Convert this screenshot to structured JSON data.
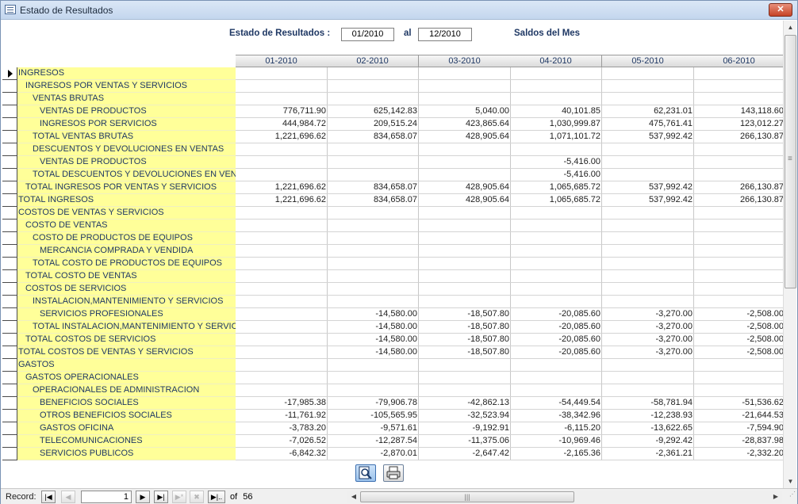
{
  "window": {
    "title": "Estado de Resultados",
    "close_glyph": "✕"
  },
  "header": {
    "label": "Estado de Resultados :",
    "from": "01/2010",
    "to_label": "al",
    "to": "12/2010",
    "mode": "Saldos del Mes"
  },
  "columns": [
    "01-2010",
    "02-2010",
    "03-2010",
    "04-2010",
    "05-2010",
    "06-2010"
  ],
  "rows": [
    {
      "label": "INGRESOS",
      "indent": 0,
      "values": [
        "",
        "",
        "",
        "",
        "",
        ""
      ]
    },
    {
      "label": "INGRESOS POR VENTAS Y SERVICIOS",
      "indent": 1,
      "values": [
        "",
        "",
        "",
        "",
        "",
        ""
      ]
    },
    {
      "label": "VENTAS BRUTAS",
      "indent": 2,
      "values": [
        "",
        "",
        "",
        "",
        "",
        ""
      ]
    },
    {
      "label": "VENTAS DE PRODUCTOS",
      "indent": 3,
      "values": [
        "776,711.90",
        "625,142.83",
        "5,040.00",
        "40,101.85",
        "62,231.01",
        "143,118.60"
      ]
    },
    {
      "label": "INGRESOS POR SERVICIOS",
      "indent": 3,
      "values": [
        "444,984.72",
        "209,515.24",
        "423,865.64",
        "1,030,999.87",
        "475,761.41",
        "123,012.27"
      ]
    },
    {
      "label": "TOTAL VENTAS BRUTAS",
      "indent": 2,
      "values": [
        "1,221,696.62",
        "834,658.07",
        "428,905.64",
        "1,071,101.72",
        "537,992.42",
        "266,130.87"
      ]
    },
    {
      "label": "DESCUENTOS Y DEVOLUCIONES EN VENTAS",
      "indent": 2,
      "values": [
        "",
        "",
        "",
        "",
        "",
        ""
      ]
    },
    {
      "label": "VENTAS DE PRODUCTOS",
      "indent": 3,
      "values": [
        "",
        "",
        "",
        "-5,416.00",
        "",
        ""
      ]
    },
    {
      "label": "TOTAL DESCUENTOS Y DEVOLUCIONES EN VENTAS",
      "indent": 2,
      "values": [
        "",
        "",
        "",
        "-5,416.00",
        "",
        ""
      ]
    },
    {
      "label": "TOTAL INGRESOS POR VENTAS Y SERVICIOS",
      "indent": 1,
      "values": [
        "1,221,696.62",
        "834,658.07",
        "428,905.64",
        "1,065,685.72",
        "537,992.42",
        "266,130.87"
      ]
    },
    {
      "label": "TOTAL INGRESOS",
      "indent": 0,
      "values": [
        "1,221,696.62",
        "834,658.07",
        "428,905.64",
        "1,065,685.72",
        "537,992.42",
        "266,130.87"
      ]
    },
    {
      "label": "COSTOS DE VENTAS Y SERVICIOS",
      "indent": 0,
      "values": [
        "",
        "",
        "",
        "",
        "",
        ""
      ]
    },
    {
      "label": "COSTO DE VENTAS",
      "indent": 1,
      "values": [
        "",
        "",
        "",
        "",
        "",
        ""
      ]
    },
    {
      "label": "COSTO DE PRODUCTOS DE EQUIPOS",
      "indent": 2,
      "values": [
        "",
        "",
        "",
        "",
        "",
        ""
      ]
    },
    {
      "label": "MERCANCIA COMPRADA Y VENDIDA",
      "indent": 3,
      "values": [
        "",
        "",
        "",
        "",
        "",
        ""
      ]
    },
    {
      "label": "TOTAL COSTO DE PRODUCTOS DE EQUIPOS",
      "indent": 2,
      "values": [
        "",
        "",
        "",
        "",
        "",
        ""
      ]
    },
    {
      "label": "TOTAL COSTO DE VENTAS",
      "indent": 1,
      "values": [
        "",
        "",
        "",
        "",
        "",
        ""
      ]
    },
    {
      "label": "COSTOS DE SERVICIOS",
      "indent": 1,
      "values": [
        "",
        "",
        "",
        "",
        "",
        ""
      ]
    },
    {
      "label": "INSTALACION,MANTENIMIENTO Y SERVICIOS",
      "indent": 2,
      "values": [
        "",
        "",
        "",
        "",
        "",
        ""
      ]
    },
    {
      "label": "SERVICIOS PROFESIONALES",
      "indent": 3,
      "values": [
        "",
        "-14,580.00",
        "-18,507.80",
        "-20,085.60",
        "-3,270.00",
        "-2,508.00"
      ]
    },
    {
      "label": "TOTAL INSTALACION,MANTENIMIENTO Y SERVICIOS",
      "indent": 2,
      "values": [
        "",
        "-14,580.00",
        "-18,507.80",
        "-20,085.60",
        "-3,270.00",
        "-2,508.00"
      ]
    },
    {
      "label": "TOTAL COSTOS DE SERVICIOS",
      "indent": 1,
      "values": [
        "",
        "-14,580.00",
        "-18,507.80",
        "-20,085.60",
        "-3,270.00",
        "-2,508.00"
      ]
    },
    {
      "label": "TOTAL COSTOS DE VENTAS Y SERVICIOS",
      "indent": 0,
      "values": [
        "",
        "-14,580.00",
        "-18,507.80",
        "-20,085.60",
        "-3,270.00",
        "-2,508.00"
      ]
    },
    {
      "label": "GASTOS",
      "indent": 0,
      "values": [
        "",
        "",
        "",
        "",
        "",
        ""
      ]
    },
    {
      "label": "GASTOS OPERACIONALES",
      "indent": 1,
      "values": [
        "",
        "",
        "",
        "",
        "",
        ""
      ]
    },
    {
      "label": "OPERACIONALES DE ADMINISTRACION",
      "indent": 2,
      "values": [
        "",
        "",
        "",
        "",
        "",
        ""
      ]
    },
    {
      "label": "BENEFICIOS SOCIALES",
      "indent": 3,
      "values": [
        "-17,985.38",
        "-79,906.78",
        "-42,862.13",
        "-54,449.54",
        "-58,781.94",
        "-51,536.62"
      ]
    },
    {
      "label": "OTROS BENEFICIOS SOCIALES",
      "indent": 3,
      "values": [
        "-11,761.92",
        "-105,565.95",
        "-32,523.94",
        "-38,342.96",
        "-12,238.93",
        "-21,644.53"
      ]
    },
    {
      "label": "GASTOS OFICINA",
      "indent": 3,
      "values": [
        "-3,783.20",
        "-9,571.61",
        "-9,192.91",
        "-6,115.20",
        "-13,622.65",
        "-7,594.90"
      ]
    },
    {
      "label": "TELECOMUNICACIONES",
      "indent": 3,
      "values": [
        "-7,026.52",
        "-12,287.54",
        "-11,375.06",
        "-10,969.46",
        "-9,292.42",
        "-28,837.98"
      ]
    },
    {
      "label": "SERVICIOS PUBLICOS",
      "indent": 3,
      "values": [
        "-6,842.32",
        "-2,870.01",
        "-2,647.42",
        "-2,165.36",
        "-2,361.21",
        "-2,332.20"
      ]
    }
  ],
  "toolbar": {
    "preview_icon": "print-preview-icon",
    "print_icon": "printer-icon"
  },
  "navigation": {
    "record_label": "Record:",
    "current": "1",
    "of_label": "of",
    "total": "56",
    "first": "|◀",
    "prev": "◀",
    "next": "▶",
    "last": "▶|",
    "new": "▶*",
    "delete": "✖",
    "find": "▶|.."
  },
  "colors": {
    "label_bg": "#ffff99",
    "header_text": "#1f3864"
  }
}
